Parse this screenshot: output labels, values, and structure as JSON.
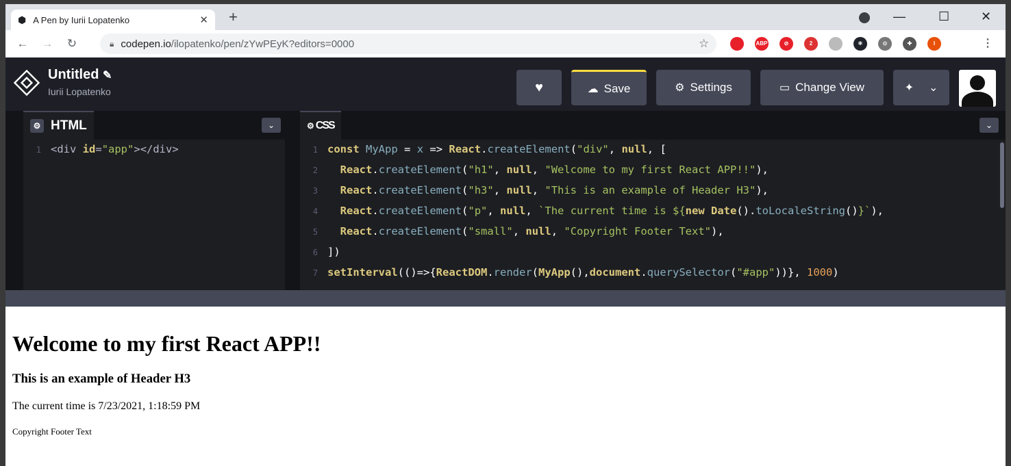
{
  "browser": {
    "tab_title": "A Pen by Iurii Lopatenko",
    "tab_close": "✕",
    "new_tab": "+",
    "url_host": "codepen.io",
    "url_path": "/ilopatenko/pen/zYwPEyK?editors=0000",
    "controls": {
      "minimize": "—",
      "maximize": "☐",
      "close": "✕"
    },
    "extensions": [
      {
        "name": "ublock-icon",
        "color": "#e8202a",
        "label": ""
      },
      {
        "name": "abp-icon",
        "color": "#e8202a",
        "label": "ABP"
      },
      {
        "name": "block-icon",
        "color": "#e8202a",
        "label": "⊘"
      },
      {
        "name": "ext-badge-icon",
        "color": "#d33",
        "label": "2"
      },
      {
        "name": "ext-grey-icon",
        "color": "#bbb",
        "label": ""
      },
      {
        "name": "react-devtools-icon",
        "color": "#20232a",
        "label": "⚛"
      },
      {
        "name": "ext-dots-icon",
        "color": "#777",
        "label": "⊙"
      },
      {
        "name": "puzzle-icon",
        "color": "#555",
        "label": "✚"
      },
      {
        "name": "profile-icon",
        "color": "#e8510a",
        "label": "I"
      }
    ]
  },
  "codepen": {
    "title": "Untitled",
    "edit_icon": "✎",
    "user": "Iurii Lopatenko",
    "buttons": {
      "love": "♥",
      "save": "Save",
      "settings": "Settings",
      "change_view": "Change View",
      "pin": "✦",
      "more": "⌄"
    }
  },
  "editors": {
    "html": {
      "label": "HTML",
      "lines": [
        "<div id=\"app\"></div>"
      ]
    },
    "js": {
      "label": "CSS",
      "line_numbers": [
        "1",
        "2",
        "3",
        "4",
        "5",
        "6",
        "7"
      ]
    },
    "chevron": "⌄"
  },
  "preview": {
    "h1": "Welcome to my first React APP!!",
    "h3": "This is an example of Header H3",
    "p": "The current time is 7/23/2021, 1:18:59 PM",
    "small": "Copyright Footer Text"
  }
}
